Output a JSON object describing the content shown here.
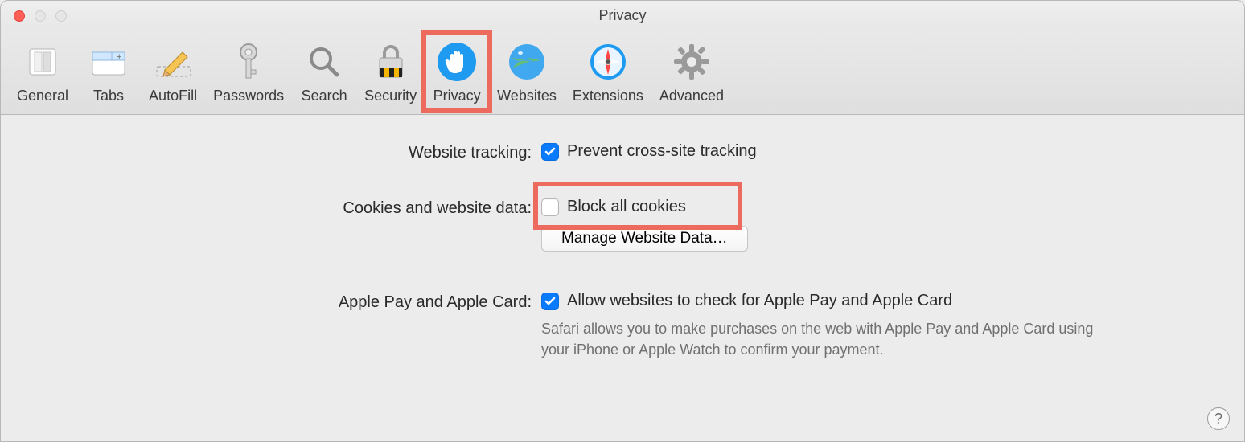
{
  "window": {
    "title": "Privacy"
  },
  "toolbar": {
    "items": [
      {
        "label": "General"
      },
      {
        "label": "Tabs"
      },
      {
        "label": "AutoFill"
      },
      {
        "label": "Passwords"
      },
      {
        "label": "Search"
      },
      {
        "label": "Security"
      },
      {
        "label": "Privacy"
      },
      {
        "label": "Websites"
      },
      {
        "label": "Extensions"
      },
      {
        "label": "Advanced"
      }
    ],
    "selected_index": 6
  },
  "sections": {
    "tracking": {
      "label": "Website tracking:",
      "checkbox_label": "Prevent cross-site tracking",
      "checked": true
    },
    "cookies": {
      "label": "Cookies and website data:",
      "checkbox_label": "Block all cookies",
      "checked": false,
      "button_label": "Manage Website Data…"
    },
    "applepay": {
      "label": "Apple Pay and Apple Card:",
      "checkbox_label": "Allow websites to check for Apple Pay and Apple Card",
      "checked": true,
      "description": "Safari allows you to make purchases on the web with Apple Pay and Apple Card using your iPhone or Apple Watch to confirm your payment."
    }
  },
  "help": "?"
}
